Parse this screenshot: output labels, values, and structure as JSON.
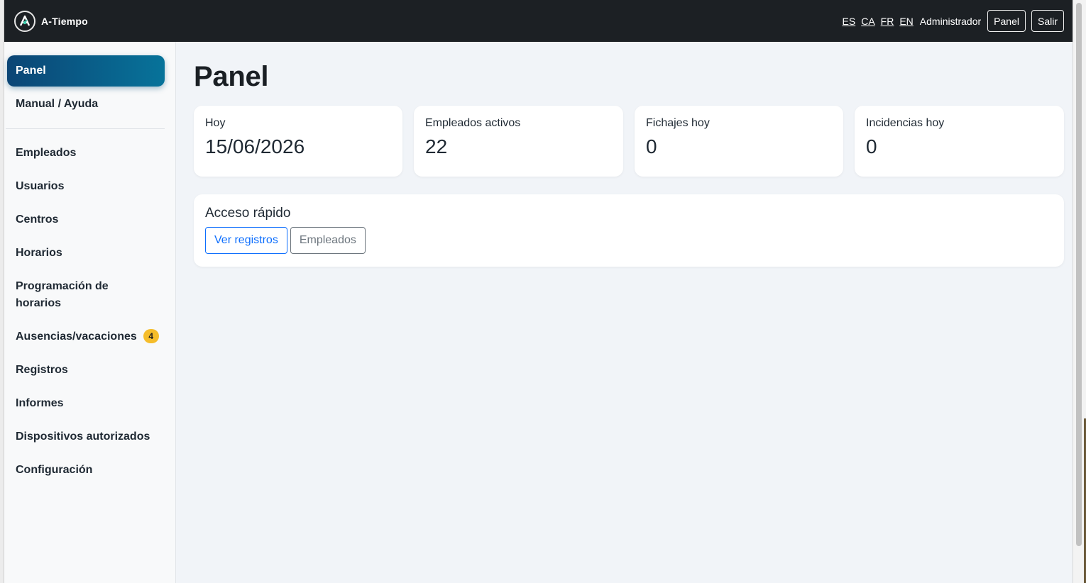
{
  "topbar": {
    "brand_name": "A-Tiempo",
    "languages": [
      "ES",
      "CA",
      "FR",
      "EN"
    ],
    "user_label": "Administrador",
    "panel_button": "Panel",
    "logout_button": "Salir"
  },
  "sidebar": {
    "active": "Panel",
    "help": "Manual / Ayuda",
    "items": [
      {
        "label": "Empleados"
      },
      {
        "label": "Usuarios"
      },
      {
        "label": "Centros"
      },
      {
        "label": "Horarios"
      },
      {
        "label": "Programación de horarios"
      },
      {
        "label": "Ausencias/vacaciones",
        "badge": "4"
      },
      {
        "label": "Registros"
      },
      {
        "label": "Informes"
      },
      {
        "label": "Dispositivos autorizados"
      },
      {
        "label": "Configuración"
      }
    ]
  },
  "main": {
    "title": "Panel",
    "stats": [
      {
        "label": "Hoy",
        "value": "15/06/2026"
      },
      {
        "label": "Empleados activos",
        "value": "22"
      },
      {
        "label": "Fichajes hoy",
        "value": "0"
      },
      {
        "label": "Incidencias hoy",
        "value": "0"
      }
    ],
    "quick_access": {
      "title": "Acceso rápido",
      "buttons": [
        "Ver registros",
        "Empleados"
      ]
    }
  },
  "colors": {
    "topbar_bg": "#1c2024",
    "active_nav_start": "#0b4575",
    "active_nav_end": "#07739a",
    "badge": "#f5bd2b",
    "primary": "#0d6efd",
    "secondary": "#6c757d",
    "page_bg": "#f1f4f8"
  }
}
